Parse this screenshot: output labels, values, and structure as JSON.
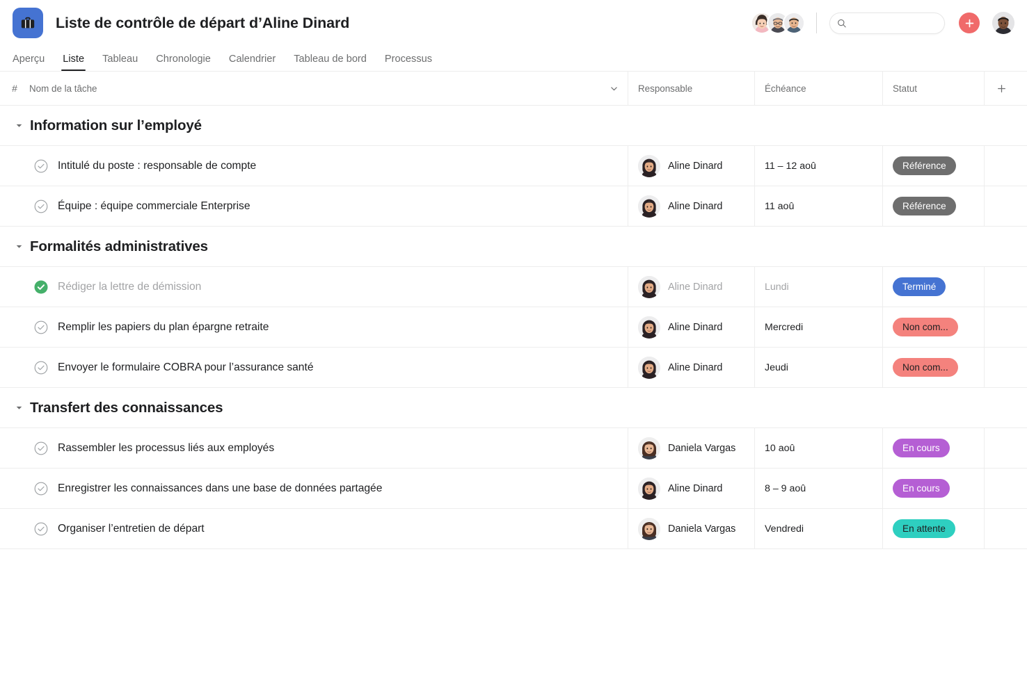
{
  "app": {
    "logo_icon": "briefcase-icon",
    "title": "Liste de contrôle de départ d’Aline Dinard"
  },
  "tabs": [
    {
      "label": "Aperçu",
      "active": false
    },
    {
      "label": "Liste",
      "active": true
    },
    {
      "label": "Tableau",
      "active": false
    },
    {
      "label": "Chronologie",
      "active": false
    },
    {
      "label": "Calendrier",
      "active": false
    },
    {
      "label": "Tableau de bord",
      "active": false
    },
    {
      "label": "Processus",
      "active": false
    }
  ],
  "search": {
    "value": "",
    "placeholder": "",
    "icon": "search-icon"
  },
  "actions": {
    "add_icon": "plus-icon",
    "add_label": "+"
  },
  "columns": {
    "number": "#",
    "task_name": "Nom de la tâche",
    "assignee": "Responsable",
    "due": "Échéance",
    "status": "Statut",
    "add": "+"
  },
  "status_colors": {
    "reference_bg": "#6e6e6e",
    "reference_fg": "#ffffff",
    "termine_bg": "#4573d2",
    "termine_fg": "#ffffff",
    "non_commence_bg": "#f4827d",
    "non_commence_fg": "#1e1f21",
    "en_cours_bg": "#b55fd4",
    "en_cours_fg": "#ffffff",
    "en_attente_bg": "#2ecfc0",
    "en_attente_fg": "#1e1f21"
  },
  "sections": [
    {
      "title": "Information sur l’employé",
      "tasks": [
        {
          "name": "Intitulé du poste : responsable de compte",
          "assignee": "Aline Dinard",
          "avatar": "aline",
          "due": "11 – 12 aoû",
          "status": "Référence",
          "status_key": "reference",
          "completed": false
        },
        {
          "name": "Équipe : équipe commerciale Enterprise",
          "assignee": "Aline Dinard",
          "avatar": "aline",
          "due": "11 aoû",
          "status": "Référence",
          "status_key": "reference",
          "completed": false
        }
      ]
    },
    {
      "title": "Formalités administratives",
      "tasks": [
        {
          "name": "Rédiger la lettre de démission",
          "assignee": "Aline Dinard",
          "avatar": "aline",
          "due": "Lundi",
          "status": "Terminé",
          "status_key": "termine",
          "completed": true
        },
        {
          "name": "Remplir les papiers du plan épargne retraite",
          "assignee": "Aline Dinard",
          "avatar": "aline",
          "due": "Mercredi",
          "status": "Non com...",
          "status_key": "non_commence",
          "completed": false
        },
        {
          "name": "Envoyer le formulaire COBRA pour l’assurance santé",
          "assignee": "Aline Dinard",
          "avatar": "aline",
          "due": "Jeudi",
          "status": "Non com...",
          "status_key": "non_commence",
          "completed": false
        }
      ]
    },
    {
      "title": "Transfert des connaissances",
      "tasks": [
        {
          "name": "Rassembler les processus liés aux employés",
          "assignee": "Daniela Vargas",
          "avatar": "daniela",
          "due": "10 aoû",
          "status": "En cours",
          "status_key": "en_cours",
          "completed": false
        },
        {
          "name": "Enregistrer les connaissances dans une base de données partagée",
          "assignee": "Aline Dinard",
          "avatar": "aline",
          "due": "8 – 9 aoû",
          "status": "En cours",
          "status_key": "en_cours",
          "completed": false
        },
        {
          "name": "Organiser l’entretien de départ",
          "assignee": "Daniela Vargas",
          "avatar": "daniela",
          "due": "Vendredi",
          "status": "En attente",
          "status_key": "en_attente",
          "completed": false
        }
      ]
    }
  ],
  "members": [
    {
      "name": "member-1",
      "avatar": "m1"
    },
    {
      "name": "member-2",
      "avatar": "m2"
    },
    {
      "name": "member-3",
      "avatar": "m3"
    }
  ],
  "current_user": {
    "avatar": "me"
  }
}
